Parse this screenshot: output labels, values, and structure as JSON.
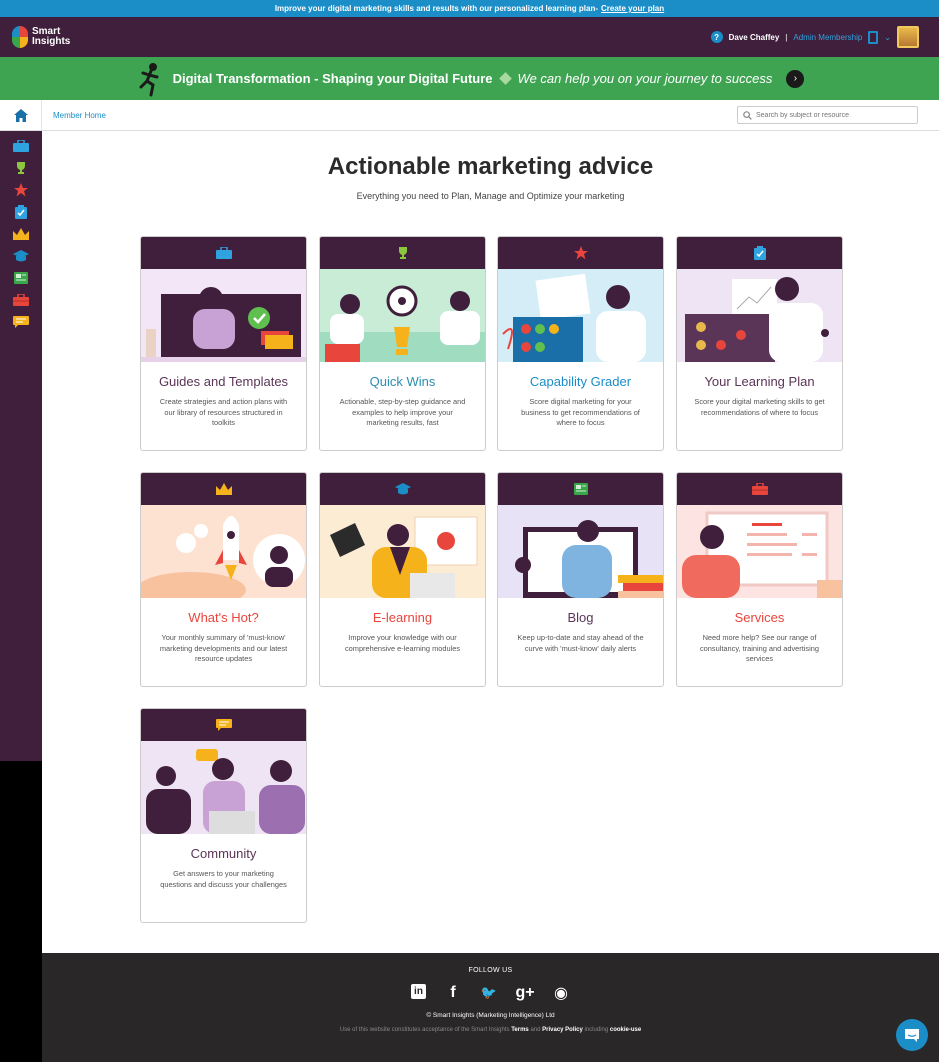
{
  "promo_bar": {
    "text": "Improve your digital marketing skills and results with our personalized learning plan-",
    "link": "Create your plan"
  },
  "header": {
    "logo_line1": "Smart",
    "logo_line2": "Insights",
    "user_name": "Dave Chaffey",
    "separator": "|",
    "membership": "Admin Membership",
    "help_label": "?"
  },
  "banner": {
    "title": "Digital Transformation - Shaping your Digital Future",
    "tagline": "We can help you on your journey to success",
    "arrow": "›"
  },
  "nav": {
    "breadcrumb": "Member Home",
    "search_placeholder": "Search by subject or resource"
  },
  "sidebar": {
    "icons": [
      "briefcase-icon",
      "trophy-icon",
      "star-icon",
      "clipboard-icon",
      "crown-icon",
      "graduation-cap-icon",
      "newspaper-icon",
      "toolbox-icon",
      "chat-icon"
    ]
  },
  "page": {
    "title": "Actionable marketing advice",
    "subtitle": "Everything you need to Plan, Manage and Optimize your marketing"
  },
  "cards": [
    {
      "title": "Guides and Templates",
      "desc": "Create strategies and action plans with our library of resources structured in toolkits",
      "color": "#5b3557",
      "icon": "briefcase-icon"
    },
    {
      "title": "Quick Wins",
      "desc": "Actionable, step-by-step guidance and examples to help improve your marketing results, fast",
      "color": "#2a8fb0",
      "icon": "trophy-icon"
    },
    {
      "title": "Capability Grader",
      "desc": "Score digital marketing for your business to get recommendations of where to focus",
      "color": "#1b8ec8",
      "icon": "star-icon"
    },
    {
      "title": "Your Learning Plan",
      "desc": "Score your digital marketing skills to get recommendations of where to focus",
      "color": "#5b3557",
      "icon": "clipboard-icon"
    },
    {
      "title": "What's Hot?",
      "desc": "Your monthly summary of 'must-know' marketing developments and our latest resource updates",
      "color": "#e8453c",
      "icon": "crown-icon"
    },
    {
      "title": "E-learning",
      "desc": "Improve your knowledge with our comprehensive e-learning modules",
      "color": "#e8453c",
      "icon": "graduation-cap-icon"
    },
    {
      "title": "Blog",
      "desc": "Keep up-to-date and stay ahead of the curve with 'must-know' daily alerts",
      "color": "#5b3557",
      "icon": "newspaper-icon"
    },
    {
      "title": "Services",
      "desc": "Need more help? See our range of consultancy, training and advertising services",
      "color": "#e8453c",
      "icon": "toolbox-icon"
    },
    {
      "title": "Community",
      "desc": "Get answers to your marketing questions and discuss your challenges",
      "color": "#5b3557",
      "icon": "chat-icon"
    }
  ],
  "footer": {
    "follow": "FOLLOW US",
    "social": [
      "in",
      "f",
      "🐦",
      "g+",
      "◉"
    ],
    "copyright": "© Smart Insights (Marketing Intelligence) Ltd",
    "terms_prefix": "Use of this website constitutes acceptance of the Smart Insights",
    "terms_link": "Terms",
    "and": "and",
    "privacy_link": "Privacy Policy",
    "including": "including",
    "cookie_link": "cookie-use"
  }
}
